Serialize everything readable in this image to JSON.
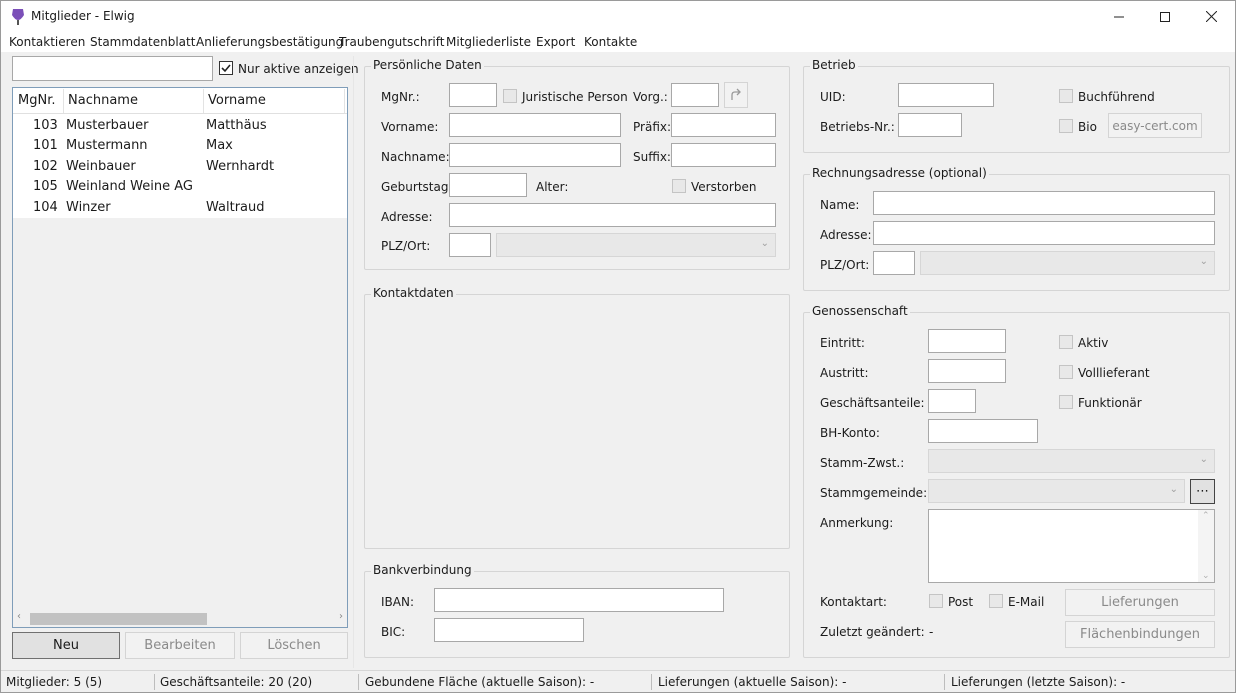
{
  "window": {
    "title": "Mitglieder - Elwig"
  },
  "menu": [
    "Kontaktieren",
    "Stammdatenblatt",
    "Anlieferungsbestätigung",
    "Traubengutschrift",
    "Mitgliederliste",
    "Export",
    "Kontakte"
  ],
  "left": {
    "search_value": "",
    "filter_label": "Nur aktive anzeigen",
    "filter_checked": true,
    "columns": [
      "MgNr.",
      "Nachname",
      "Vorname"
    ],
    "rows": [
      {
        "nr": "103",
        "nachname": "Musterbauer",
        "vorname": "Matthäus"
      },
      {
        "nr": "101",
        "nachname": "Mustermann",
        "vorname": "Max"
      },
      {
        "nr": "102",
        "nachname": "Weinbauer",
        "vorname": "Wernhardt"
      },
      {
        "nr": "105",
        "nachname": "Weinland Weine AG",
        "vorname": ""
      },
      {
        "nr": "104",
        "nachname": "Winzer",
        "vorname": "Waltraud"
      }
    ],
    "buttons": {
      "neu": "Neu",
      "bearbeiten": "Bearbeiten",
      "loeschen": "Löschen"
    }
  },
  "personal": {
    "title": "Persönliche Daten",
    "mgnr": "MgNr.:",
    "juristisch": "Juristische Person",
    "vorg": "Vorg.:",
    "vorname": "Vorname:",
    "praefix": "Präfix:",
    "nachname": "Nachname:",
    "suffix": "Suffix:",
    "geburtstag": "Geburtstag:",
    "alter": "Alter:",
    "verstorben": "Verstorben",
    "adresse": "Adresse:",
    "plzort": "PLZ/Ort:"
  },
  "kontakt": {
    "title": "Kontaktdaten"
  },
  "bank": {
    "title": "Bankverbindung",
    "iban": "IBAN:",
    "bic": "BIC:"
  },
  "betrieb": {
    "title": "Betrieb",
    "uid": "UID:",
    "betriebsnr": "Betriebs-Nr.:",
    "buchfuehrend": "Buchführend",
    "bio": "Bio",
    "cert_button": "easy-cert.com"
  },
  "rechnung": {
    "title": "Rechnungsadresse (optional)",
    "name": "Name:",
    "adresse": "Adresse:",
    "plzort": "PLZ/Ort:"
  },
  "genossenschaft": {
    "title": "Genossenschaft",
    "eintritt": "Eintritt:",
    "austritt": "Austritt:",
    "anteile": "Geschäftsanteile:",
    "bhkonto": "BH-Konto:",
    "zwst": "Stamm-Zwst.:",
    "gemeinde": "Stammgemeinde:",
    "anmerkung": "Anmerkung:",
    "aktiv": "Aktiv",
    "volllieferant": "Volllieferant",
    "funktionaer": "Funktionär",
    "kontaktart": "Kontaktart:",
    "post": "Post",
    "email": "E-Mail",
    "geaendert_label": "Zuletzt geändert:",
    "geaendert_value": "-",
    "lieferungen_btn": "Lieferungen",
    "flaechen_btn": "Flächenbindungen",
    "more_btn": "⋯"
  },
  "status": [
    "Mitglieder: 5 (5)",
    "Geschäftsanteile: 20 (20)",
    "Gebundene Fläche (aktuelle Saison): -",
    "Lieferungen (aktuelle Saison): -",
    "Lieferungen (letzte Saison): -"
  ]
}
